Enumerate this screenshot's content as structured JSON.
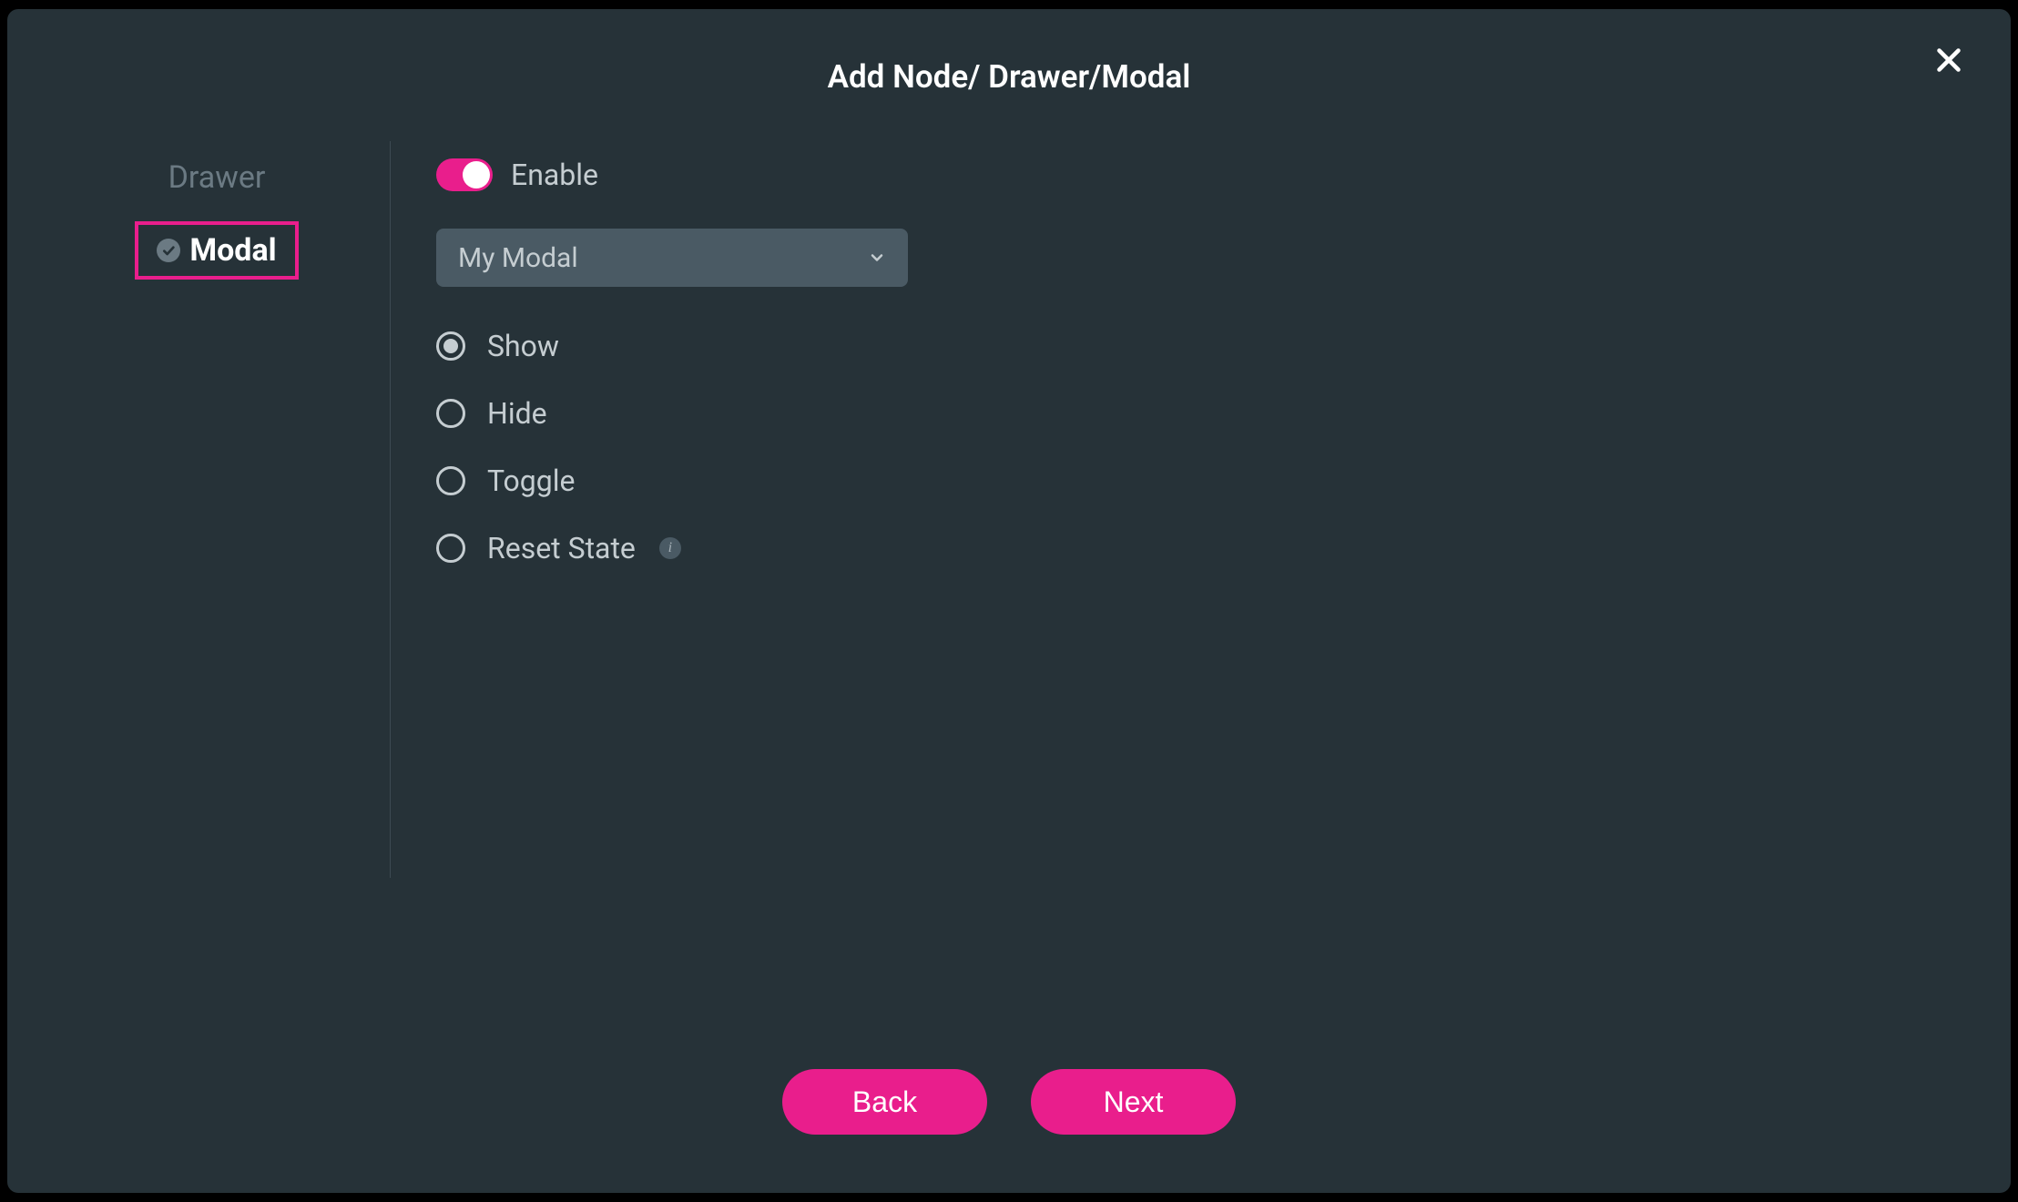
{
  "title": "Add Node/ Drawer/Modal",
  "sidebar": {
    "items": [
      {
        "label": "Drawer",
        "active": false
      },
      {
        "label": "Modal",
        "active": true
      }
    ]
  },
  "content": {
    "enable_label": "Enable",
    "enable_value": true,
    "dropdown_value": "My Modal",
    "radio_options": [
      {
        "label": "Show",
        "selected": true
      },
      {
        "label": "Hide",
        "selected": false
      },
      {
        "label": "Toggle",
        "selected": false
      },
      {
        "label": "Reset State",
        "selected": false,
        "info": true
      }
    ]
  },
  "footer": {
    "back_label": "Back",
    "next_label": "Next"
  },
  "colors": {
    "accent": "#e91e8c",
    "background": "#263238"
  }
}
